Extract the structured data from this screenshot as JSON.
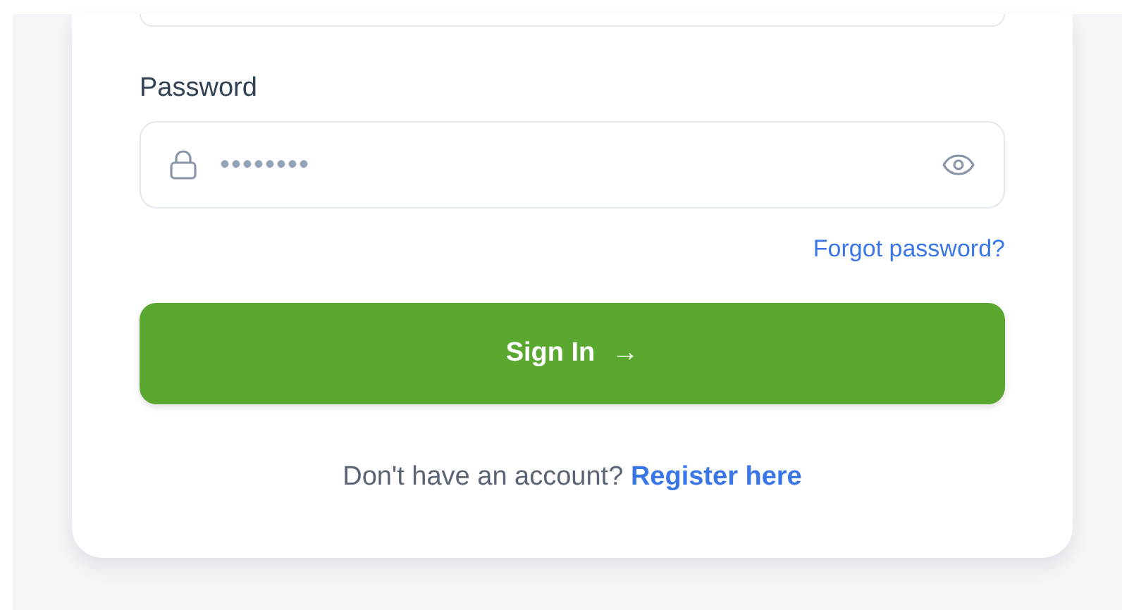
{
  "password": {
    "label": "Password",
    "value": "••••••••"
  },
  "forgot_link": "Forgot password?",
  "sign_in_button": {
    "label": "Sign In",
    "arrow": "→"
  },
  "register": {
    "prompt": "Don't have an account?",
    "link": "Register here"
  }
}
